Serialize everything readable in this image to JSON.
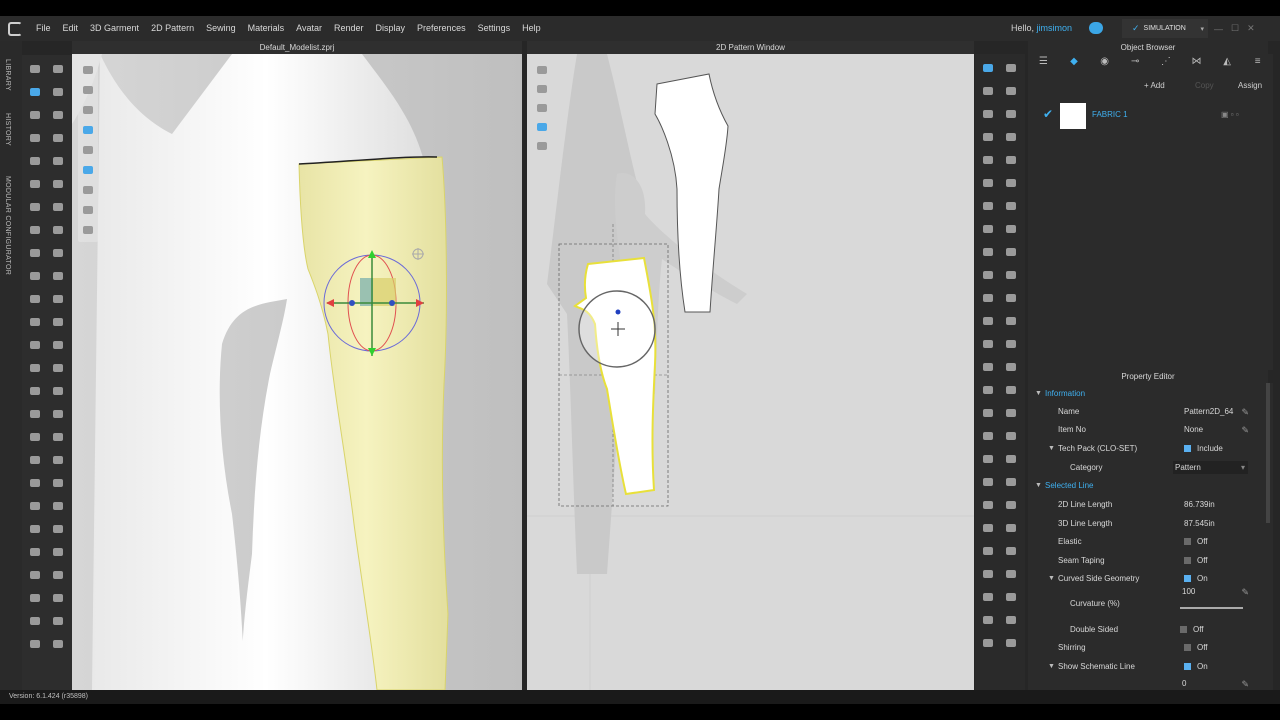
{
  "app": {
    "brand_icon": "clo-logo-icon"
  },
  "menu": {
    "items": [
      "File",
      "Edit",
      "3D Garment",
      "2D Pattern",
      "Sewing",
      "Materials",
      "Avatar",
      "Render",
      "Display",
      "Preferences",
      "Settings",
      "Help"
    ],
    "greeting_prefix": "Hello, ",
    "username": "jimsimon",
    "mode": "SIMULATION"
  },
  "side_tabs": [
    "LIBRARY",
    "HISTORY",
    "MODULAR CONFIGURATOR"
  ],
  "viewport_3d": {
    "title": "Default_Modelist.zprj"
  },
  "pattern_window": {
    "title": "2D Pattern Window"
  },
  "object_browser": {
    "title": "Object Browser",
    "add_label": "+ Add",
    "copy_label": "Copy",
    "assign_label": "Assign",
    "fabric_name": "FABRIC 1"
  },
  "property_editor": {
    "title": "Property Editor",
    "info_section": "Information",
    "name_label": "Name",
    "name_value": "Pattern2D_64",
    "item_no_label": "Item No",
    "item_no_value": "None",
    "tech_pack_label": "Tech Pack (CLO-SET)",
    "tech_pack_value": "Include",
    "category_label": "Category",
    "category_value": "Pattern",
    "selected_line_section": "Selected Line",
    "len2d_label": "2D Line Length",
    "len2d_value": "86.739in",
    "len3d_label": "3D Line Length",
    "len3d_value": "87.545in",
    "elastic_label": "Elastic",
    "elastic_value": "Off",
    "seam_taping_label": "Seam Taping",
    "seam_taping_value": "Off",
    "curved_label": "Curved Side Geometry",
    "curved_value": "On",
    "curvature_label": "Curvature (%)",
    "curvature_value": "100",
    "curvature_fraction": 1.0,
    "double_sided_label": "Double Sided",
    "double_sided_value": "Off",
    "shirring_label": "Shirring",
    "shirring_value": "Off",
    "schematic_label": "Show Schematic Line",
    "schematic_value": "On",
    "last_value": "0"
  },
  "status": {
    "version": "Version: 6.1.424 (r35898)"
  },
  "colors": {
    "accent": "#3fb0f0",
    "garment": "#f3f0b8",
    "pattern_outline": "#e8e03a"
  }
}
